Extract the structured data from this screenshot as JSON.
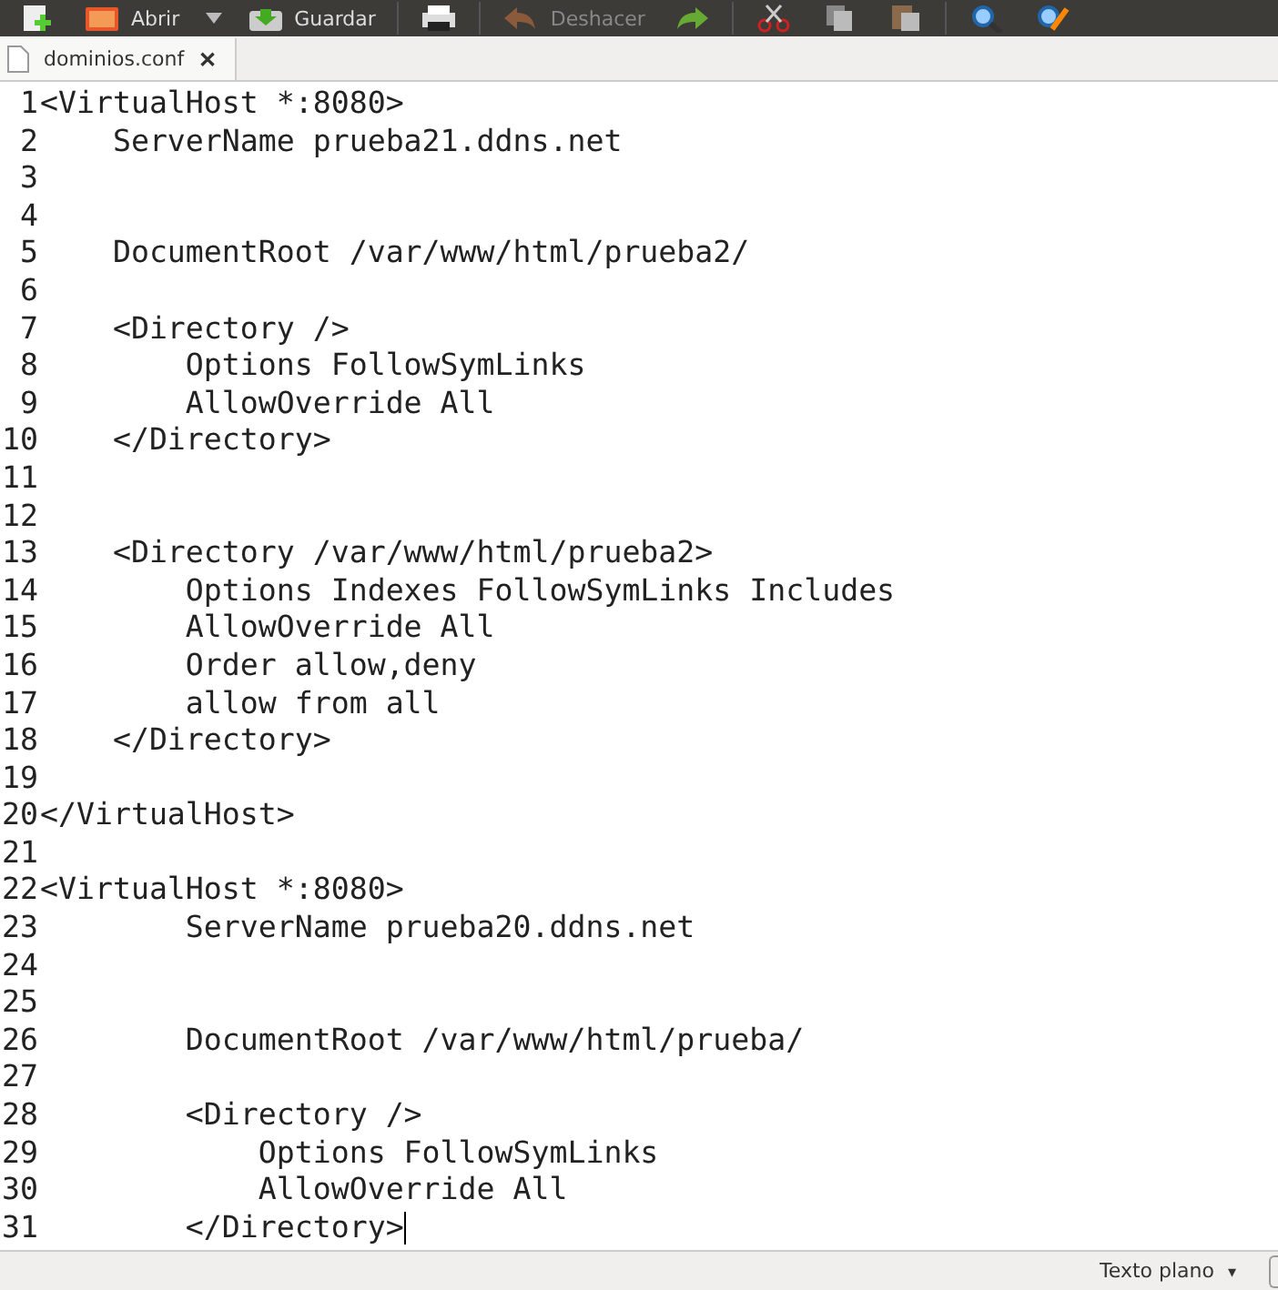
{
  "toolbar": {
    "items": [
      {
        "kind": "new"
      },
      {
        "kind": "open",
        "label": "Abrir"
      },
      {
        "kind": "dropdown"
      },
      {
        "kind": "save",
        "label": "Guardar"
      },
      {
        "kind": "separator"
      },
      {
        "kind": "print"
      },
      {
        "kind": "separator"
      },
      {
        "kind": "undo",
        "label": "Deshacer",
        "disabled": true
      },
      {
        "kind": "redo"
      },
      {
        "kind": "separator"
      },
      {
        "kind": "cut"
      },
      {
        "kind": "copy"
      },
      {
        "kind": "paste"
      },
      {
        "kind": "separator"
      },
      {
        "kind": "search"
      },
      {
        "kind": "replace"
      }
    ]
  },
  "tabs": [
    {
      "label": "dominios.conf",
      "selected": true,
      "close": "✕"
    }
  ],
  "editor": {
    "lines": [
      {
        "number": "1",
        "text": "<VirtualHost *:8080>"
      },
      {
        "number": "2",
        "text": "    ServerName prueba21.ddns.net"
      },
      {
        "number": "3"
      },
      {
        "number": "4"
      },
      {
        "number": "5",
        "text": "    DocumentRoot /var/www/html/prueba2/"
      },
      {
        "number": "6"
      },
      {
        "number": "7",
        "text": "    <Directory />"
      },
      {
        "number": "8",
        "text": "        Options FollowSymLinks"
      },
      {
        "number": "9",
        "text": "        AllowOverride All"
      },
      {
        "number": "10",
        "text": "    </Directory>"
      },
      {
        "number": "11"
      },
      {
        "number": "12"
      },
      {
        "number": "13",
        "text": "    <Directory /var/www/html/prueba2>"
      },
      {
        "number": "14",
        "text": "        Options Indexes FollowSymLinks Includes"
      },
      {
        "number": "15",
        "text": "        AllowOverride All"
      },
      {
        "number": "16",
        "text": "        Order allow,deny"
      },
      {
        "number": "17",
        "text": "        allow from all"
      },
      {
        "number": "18",
        "text": "    </Directory>"
      },
      {
        "number": "19"
      },
      {
        "number": "20",
        "text": "</VirtualHost>"
      },
      {
        "number": "21"
      },
      {
        "number": "22",
        "text": "<VirtualHost *:8080>"
      },
      {
        "number": "23",
        "text": "        ServerName prueba20.ddns.net"
      },
      {
        "number": "24"
      },
      {
        "number": "25"
      },
      {
        "number": "26",
        "text": "        DocumentRoot /var/www/html/prueba/"
      },
      {
        "number": "27"
      },
      {
        "number": "28",
        "text": "        <Directory />"
      },
      {
        "number": "29",
        "text": "            Options FollowSymLinks"
      },
      {
        "number": "30",
        "text": "            AllowOverride All"
      },
      {
        "number": "31",
        "text": "        </Directory>",
        "cursor": true
      }
    ]
  },
  "status_bar": {
    "language": "Texto plano",
    "caret": "▾"
  }
}
